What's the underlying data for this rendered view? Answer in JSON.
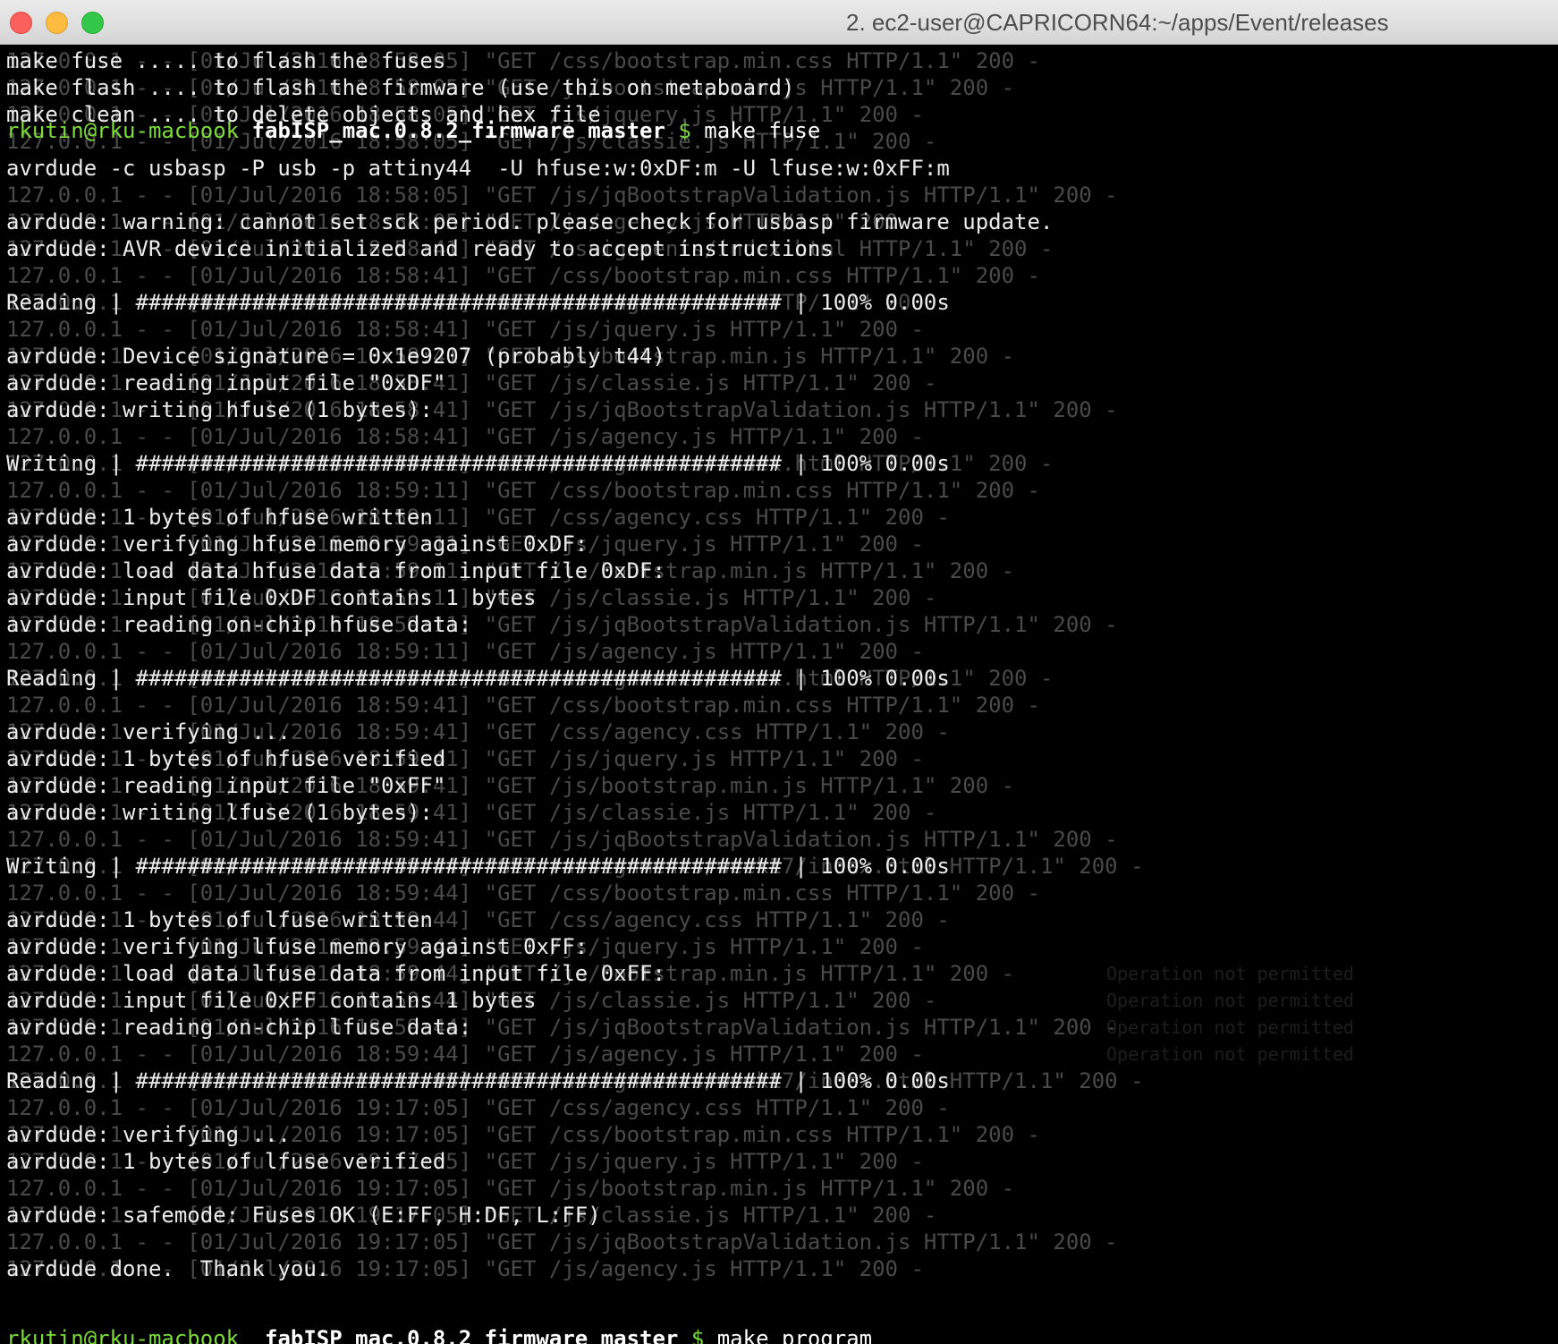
{
  "window": {
    "title": "2. ec2-user@CAPRICORN64:~/apps/Event/releases"
  },
  "prompt": {
    "user": "rkutin@rku-macbook",
    "dir": "fabISP_mac.0.8.2_firmware master",
    "dollar": "$"
  },
  "commands": {
    "first": "make fuse",
    "last": "make program"
  },
  "output_lines": [
    "make fuse ..... to flash the fuses",
    "make flash .... to flash the firmware (use this on metaboard)",
    "make clean .... to delete objects and hex file",
    "",
    "avrdude -c usbasp -P usb -p attiny44  -U hfuse:w:0xDF:m -U lfuse:w:0xFF:m",
    "",
    "avrdude: warning: cannot set sck period. please check for usbasp firmware update.",
    "avrdude: AVR device initialized and ready to accept instructions",
    "",
    "Reading | ################################################## | 100% 0.00s",
    "",
    "avrdude: Device signature = 0x1e9207 (probably t44)",
    "avrdude: reading input file \"0xDF\"",
    "avrdude: writing hfuse (1 bytes):",
    "",
    "Writing | ################################################## | 100% 0.00s",
    "",
    "avrdude: 1 bytes of hfuse written",
    "avrdude: verifying hfuse memory against 0xDF:",
    "avrdude: load data hfuse data from input file 0xDF:",
    "avrdude: input file 0xDF contains 1 bytes",
    "avrdude: reading on-chip hfuse data:",
    "",
    "Reading | ################################################## | 100% 0.00s",
    "",
    "avrdude: verifying ...",
    "avrdude: 1 bytes of hfuse verified",
    "avrdude: reading input file \"0xFF\"",
    "avrdude: writing lfuse (1 bytes):",
    "",
    "Writing | ################################################## | 100% 0.00s",
    "",
    "avrdude: 1 bytes of lfuse written",
    "avrdude: verifying lfuse memory against 0xFF:",
    "avrdude: load data lfuse data from input file 0xFF:",
    "avrdude: input file 0xFF contains 1 bytes",
    "avrdude: reading on-chip lfuse data:",
    "",
    "Reading | ################################################## | 100% 0.00s",
    "",
    "avrdude: verifying ...",
    "avrdude: 1 bytes of lfuse verified",
    "",
    "avrdude: safemode: Fuses OK (E:FF, H:DF, L:FF)",
    "",
    "avrdude done.  Thank you.",
    "",
    ""
  ],
  "background_lines": [
    "127.0.0.1 - - [01/Jul/2016 18:58:05] \"GET /css/bootstrap.min.css HTTP/1.1\" 200 -",
    "127.0.0.1 - - [01/Jul/2016 18:58:05] \"GET /js/bootstrap.min.js HTTP/1.1\" 200 -",
    "127.0.0.1 - - [01/Jul/2016 18:58:05] \"GET /js/jquery.js HTTP/1.1\" 200 -",
    "127.0.0.1 - - [01/Jul/2016 18:58:05] \"GET /js/classie.js HTTP/1.1\" 200 -",
    "",
    "127.0.0.1 - - [01/Jul/2016 18:58:05] \"GET /js/jqBootstrapValidation.js HTTP/1.1\" 200 -",
    "127.0.0.1 - - [01/Jul/2016 18:58:05] \"GET /js/agency.js HTTP/1.1\" 200 -",
    "127.0.0.1 - - [01/Jul/2016 18:58:41] \"GET /assignments/index.html HTTP/1.1\" 200 -",
    "127.0.0.1 - - [01/Jul/2016 18:58:41] \"GET /css/bootstrap.min.css HTTP/1.1\" 200 -",
    "127.0.0.1 - - [01/Jul/2016 18:58:41] \"GET /css/agency.css HTTP/1.1\" 200 -",
    "127.0.0.1 - - [01/Jul/2016 18:58:41] \"GET /js/jquery.js HTTP/1.1\" 200 -",
    "127.0.0.1 - - [01/Jul/2016 18:58:41] \"GET /js/bootstrap.min.js HTTP/1.1\" 200 -",
    "127.0.0.1 - - [01/Jul/2016 18:58:41] \"GET /js/classie.js HTTP/1.1\" 200 -",
    "127.0.0.1 - - [01/Jul/2016 18:58:41] \"GET /js/jqBootstrapValidation.js HTTP/1.1\" 200 -",
    "127.0.0.1 - - [01/Jul/2016 18:58:41] \"GET /js/agency.js HTTP/1.1\" 200 -",
    "127.0.0.1 - - [01/Jul/2016 18:59:11] \"GET /assignments/index.html HTTP/1.1\" 200 -",
    "127.0.0.1 - - [01/Jul/2016 18:59:11] \"GET /css/bootstrap.min.css HTTP/1.1\" 200 -",
    "127.0.0.1 - - [01/Jul/2016 18:59:11] \"GET /css/agency.css HTTP/1.1\" 200 -",
    "127.0.0.1 - - [01/Jul/2016 18:59:11] \"GET /js/jquery.js HTTP/1.1\" 200 -",
    "127.0.0.1 - - [01/Jul/2016 18:59:11] \"GET /js/bootstrap.min.js HTTP/1.1\" 200 -",
    "127.0.0.1 - - [01/Jul/2016 18:59:11] \"GET /js/classie.js HTTP/1.1\" 200 -",
    "127.0.0.1 - - [01/Jul/2016 18:59:11] \"GET /js/jqBootstrapValidation.js HTTP/1.1\" 200 -",
    "127.0.0.1 - - [01/Jul/2016 18:59:11] \"GET /js/agency.js HTTP/1.1\" 200 -",
    "127.0.0.1 - - [01/Jul/2016 18:59:41] \"GET /assignments/index.html HTTP/1.1\" 200 -",
    "127.0.0.1 - - [01/Jul/2016 18:59:41] \"GET /css/bootstrap.min.css HTTP/1.1\" 200 -",
    "127.0.0.1 - - [01/Jul/2016 18:59:41] \"GET /css/agency.css HTTP/1.1\" 200 -",
    "127.0.0.1 - - [01/Jul/2016 18:59:41] \"GET /js/jquery.js HTTP/1.1\" 200 -",
    "127.0.0.1 - - [01/Jul/2016 18:59:41] \"GET /js/bootstrap.min.js HTTP/1.1\" 200 -",
    "127.0.0.1 - - [01/Jul/2016 18:59:41] \"GET /js/classie.js HTTP/1.1\" 200 -",
    "127.0.0.1 - - [01/Jul/2016 18:59:41] \"GET /js/jqBootstrapValidation.js HTTP/1.1\" 200 -",
    "127.0.0.1 - - [01/Jul/2016 18:59:44] \"GET /assignments/week17/index.html HTTP/1.1\" 200 -",
    "127.0.0.1 - - [01/Jul/2016 18:59:44] \"GET /css/bootstrap.min.css HTTP/1.1\" 200 -",
    "127.0.0.1 - - [01/Jul/2016 18:59:44] \"GET /css/agency.css HTTP/1.1\" 200 -",
    "127.0.0.1 - - [01/Jul/2016 18:59:44] \"GET /js/jquery.js HTTP/1.1\" 200 -",
    "127.0.0.1 - - [01/Jul/2016 18:59:44] \"GET /js/bootstrap.min.js HTTP/1.1\" 200 -",
    "127.0.0.1 - - [01/Jul/2016 18:59:44] \"GET /js/classie.js HTTP/1.1\" 200 -",
    "127.0.0.1 - - [01/Jul/2016 18:59:44] \"GET /js/jqBootstrapValidation.js HTTP/1.1\" 200 -",
    "127.0.0.1 - - [01/Jul/2016 18:59:44] \"GET /js/agency.js HTTP/1.1\" 200 -",
    "127.0.0.1 - - [01/Jul/2016 19:17:05] \"GET /assignments/week17/index.html HTTP/1.1\" 200 -",
    "127.0.0.1 - - [01/Jul/2016 19:17:05] \"GET /css/agency.css HTTP/1.1\" 200 -",
    "127.0.0.1 - - [01/Jul/2016 19:17:05] \"GET /css/bootstrap.min.css HTTP/1.1\" 200 -",
    "127.0.0.1 - - [01/Jul/2016 19:17:05] \"GET /js/jquery.js HTTP/1.1\" 200 -",
    "127.0.0.1 - - [01/Jul/2016 19:17:05] \"GET /js/bootstrap.min.js HTTP/1.1\" 200 -",
    "127.0.0.1 - - [01/Jul/2016 19:17:05] \"GET /js/classie.js HTTP/1.1\" 200 -",
    "127.0.0.1 - - [01/Jul/2016 19:17:05] \"GET /js/jqBootstrapValidation.js HTTP/1.1\" 200 -",
    "127.0.0.1 - - [01/Jul/2016 19:17:05] \"GET /js/agency.js HTTP/1.1\" 200 -",
    "",
    ""
  ],
  "faint_right": [
    "Operation not permitted",
    "Operation not permitted",
    "Operation not permitted",
    "Operation not permitted"
  ],
  "colors": {
    "prompt_green": "#7ddc3c",
    "foreground": "#ececec",
    "ghost_text": "#4a4a4a",
    "background": "#000000"
  }
}
